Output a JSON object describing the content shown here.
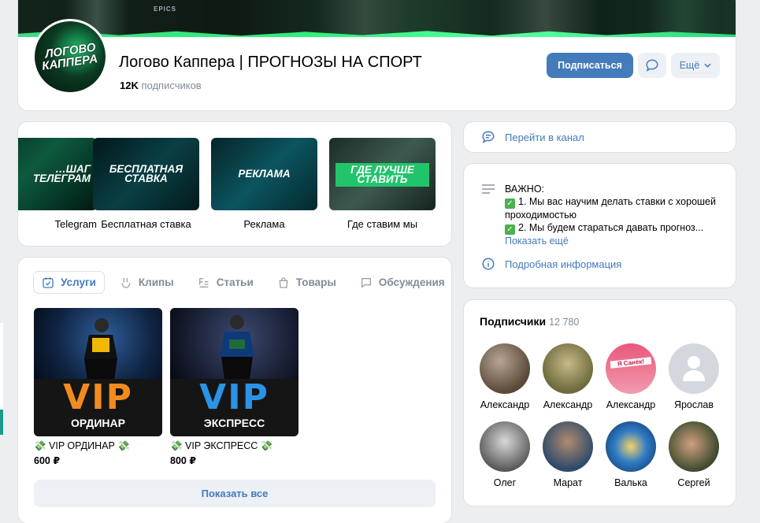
{
  "header": {
    "cover_label": "EPICS",
    "avatar_text": [
      "ЛОГОВО",
      "КАППЕРА"
    ],
    "title": "Логово Каппера | ПРОГНОЗЫ НА СПОРТ",
    "members_count": "12K",
    "members_label": "подписчиков",
    "subscribe_label": "Подписаться",
    "more_label": "Ещё"
  },
  "albums": [
    {
      "thumb_text": "…ШАГ ТЕЛЕГРАМ",
      "label": "Telegram"
    },
    {
      "thumb_text": "БЕСПЛАТНАЯ СТАВКА",
      "label": "Бесплатная ставка"
    },
    {
      "thumb_text": "РЕКЛАМА",
      "label": "Реклама"
    },
    {
      "thumb_text": "ГДЕ ЛУЧШЕ СТАВИТЬ",
      "label": "Где ставим мы"
    }
  ],
  "tabs": [
    "Услуги",
    "Клипы",
    "Статьи",
    "Товары",
    "Обсуждения"
  ],
  "products": [
    {
      "vip": "VIP",
      "sub": "ОРДИНАР",
      "name": "💸 VIP ОРДИНАР 💸",
      "price": "600 ₽",
      "vip_color": "#f28a1f",
      "jersey": "87"
    },
    {
      "vip": "VIP",
      "sub": "ЭКСПРЕСС",
      "name": "💸 VIP ЭКСПРЕСС 💸",
      "price": "800 ₽",
      "vip_color": "#2a93e8",
      "jersey": "A"
    }
  ],
  "show_all_label": "Показать все",
  "channel_label": "Перейти в канал",
  "info": {
    "line1": "ВАЖНО:",
    "line2": "1. Мы вас научим делать ставки с хорошей проходимостью",
    "line3": "2. Мы будем стараться давать прогноз...",
    "more": "Показать ещё",
    "details_label": "Подробная информация"
  },
  "subscribers": {
    "title": "Подписчики",
    "count": "12 780",
    "items": [
      {
        "name": "Александр",
        "color": "#6b5a4b"
      },
      {
        "name": "Александр",
        "color": "#8f8a5a"
      },
      {
        "name": "Александр",
        "color": "#e8587a",
        "badge": "Я Санёк!"
      },
      {
        "name": "Ярослав",
        "color": "#d4d8de"
      },
      {
        "name": "Олег",
        "color": "#8a8a8a"
      },
      {
        "name": "Марат",
        "color": "#4a6f95"
      },
      {
        "name": "Валька",
        "color": "#2f7bc5"
      },
      {
        "name": "Сергей",
        "color": "#3b4a2c"
      }
    ]
  }
}
